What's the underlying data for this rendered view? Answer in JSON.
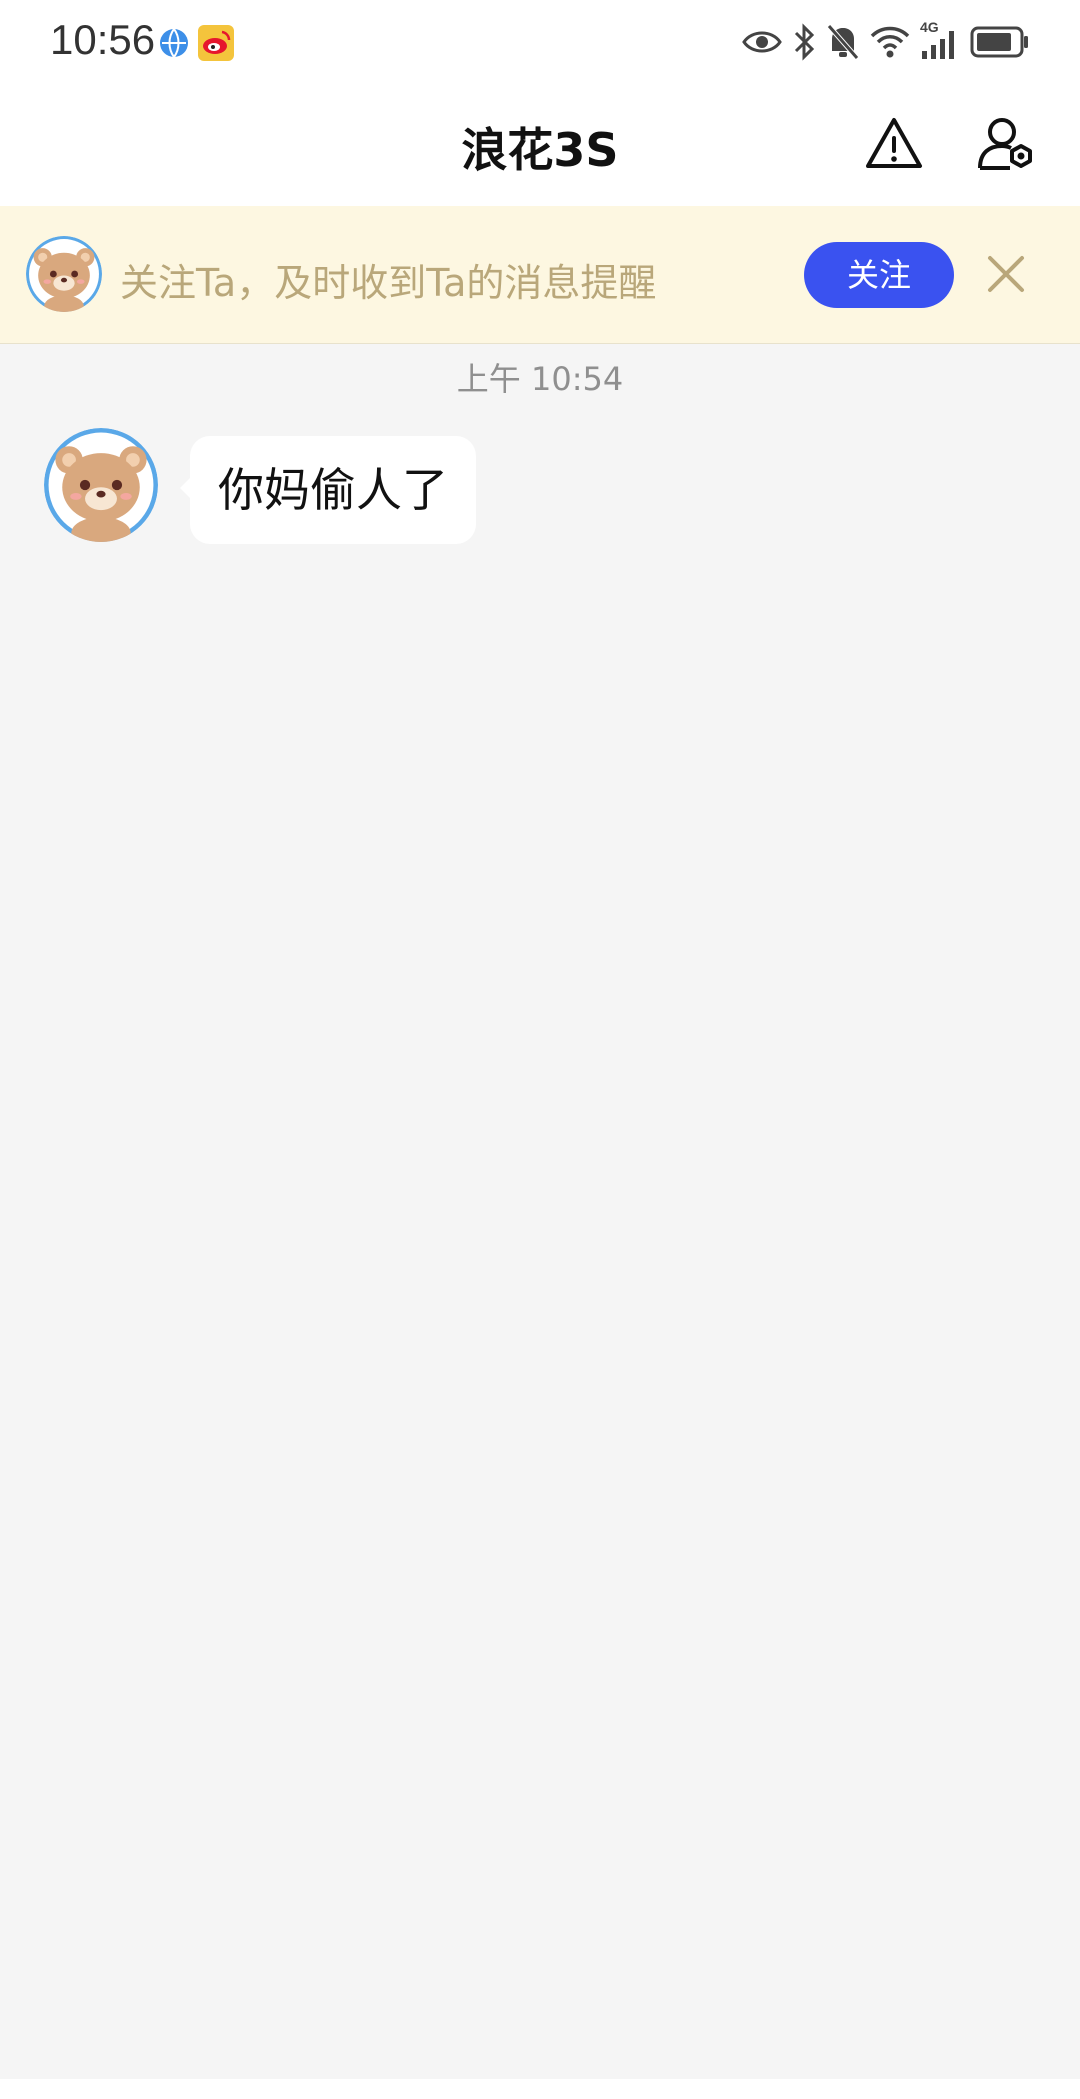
{
  "status_bar": {
    "time": "10:56",
    "left_icons": [
      "globe-icon",
      "weibo-icon"
    ],
    "right_icons": [
      "eye-icon",
      "bluetooth-icon",
      "mute-bell-icon",
      "wifi-icon",
      "signal-4g-icon",
      "battery-icon"
    ],
    "network_label": "4G"
  },
  "header": {
    "title": "浪花3S",
    "actions": [
      "report-warning-icon",
      "user-settings-icon"
    ]
  },
  "follow_banner": {
    "text": "关注Ta，及时收到Ta的消息提醒",
    "button_label": "关注",
    "close_icon": "close-icon",
    "background": "#fdf7e1",
    "button_color": "#3a52f0"
  },
  "conversation": {
    "timestamp": "上午 10:54",
    "messages": [
      {
        "sender": "other",
        "avatar": "bear-avatar",
        "text": "你妈偷人了"
      }
    ]
  }
}
